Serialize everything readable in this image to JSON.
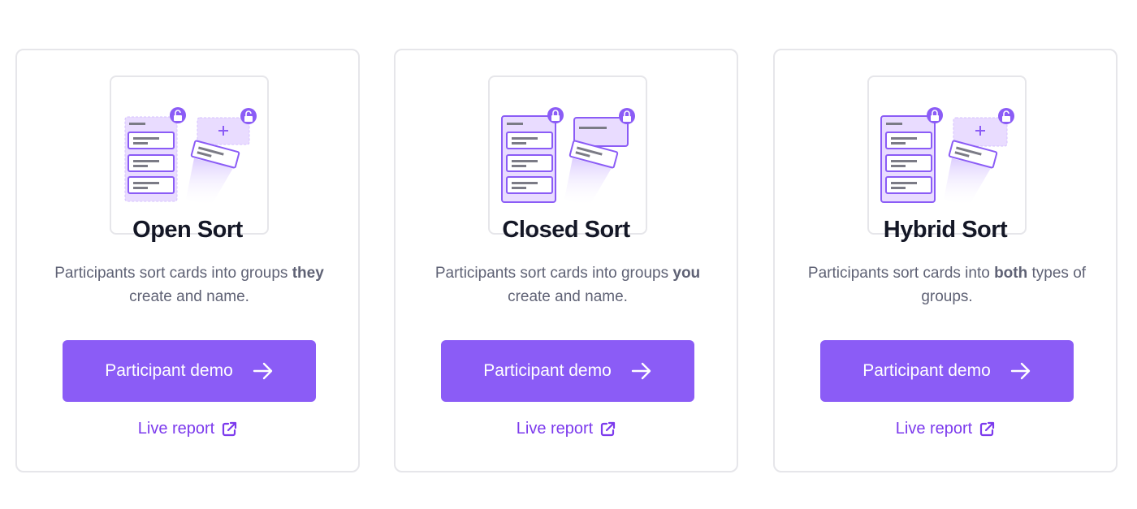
{
  "cards": [
    {
      "title": "Open Sort",
      "desc_pre": "Participants sort cards into groups ",
      "desc_bold": "they",
      "desc_post": " create and name.",
      "button_label": "Participant demo",
      "button_icon": "arrow-right-icon",
      "link_label": "Live report",
      "link_icon": "external-link-icon"
    },
    {
      "title": "Closed Sort",
      "desc_pre": "Participants sort cards into groups ",
      "desc_bold": "you",
      "desc_post": " create and name.",
      "button_label": "Participant demo",
      "button_icon": "arrow-right-icon",
      "link_label": "Live report",
      "link_icon": "external-link-icon"
    },
    {
      "title": "Hybrid Sort",
      "desc_pre": "Participants sort cards into ",
      "desc_bold": "both",
      "desc_post": " types of groups.",
      "button_label": "Participant demo",
      "button_icon": "arrow-right-icon",
      "link_label": "Live report",
      "link_icon": "external-link-icon"
    }
  ],
  "colors": {
    "accent": "#8b5cf6",
    "link": "#7c3aed",
    "illustration_stroke": "#8b5cf6",
    "illustration_fill": "#e9dcff",
    "title": "#141726",
    "body_text": "#5f6275",
    "border": "#e6e6ea"
  }
}
